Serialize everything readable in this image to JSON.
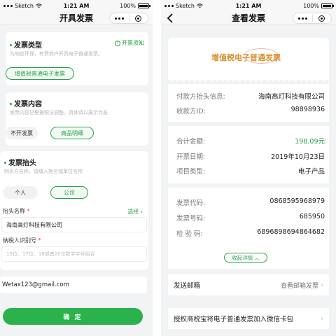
{
  "left": {
    "status": {
      "carrier": "Sketch",
      "time": "1:21 AM",
      "battery": "100%"
    },
    "nav_title": "开具发票",
    "invoice_type": {
      "title": "发票类型",
      "notice": "开票须知",
      "subtitle": "为响应环保，有赞商户开具电子普通发票。",
      "selected": "增值税普通电子发票"
    },
    "invoice_content": {
      "title": "发票内容",
      "subtitle": "发票内容已根据税法调整，具体请以展示为准",
      "options": [
        "不开发票",
        "商品明细"
      ],
      "selected_index": 1
    },
    "invoice_header": {
      "title": "发票抬头",
      "subtitle": "购买方名称，请填入姓名或单位名称",
      "options": [
        "个人",
        "公司"
      ],
      "selected_index": 1,
      "name_label": "抬头名称",
      "select_link": "选择",
      "name_value": "海南高灯科技有限公司",
      "tax_label": "纳税人识别号",
      "tax_placeholder": "15位、17位、18或者20位数字字号组合"
    },
    "email": "Wetax123@gmail.com",
    "confirm_label": "确 定"
  },
  "right": {
    "status": {
      "carrier": "Sketch",
      "time": "1:21 AM",
      "battery": "100%"
    },
    "nav_title": "查看发票",
    "invoice_title": "增值税电子普通发票",
    "payer_label": "付款方抬头信息:",
    "payer_value": "海南高灯科技有限公司",
    "payee_label": "收款方ID:",
    "payee_value": "98898936",
    "total_label": "合计金额:",
    "total_value": "198.09元",
    "date_label": "开票日期:",
    "date_value": "2019年10月23日",
    "category_label": "项目类型:",
    "category_value": "电子产品",
    "code_label": "发票代码:",
    "code_value": "0868595968979",
    "number_label": "发票号码:",
    "number_value": "685950",
    "check_label": "检 验 码:",
    "check_value": "6896898694864682",
    "collapse_label": "收起详情",
    "email_row_label": "发送邮箱",
    "email_row_value": "查看邮箱发票",
    "wechat_row_label": "授权商税宝将电子普通发票加入微信卡包"
  },
  "colors": {
    "accent": "#2aa14b",
    "title_orange": "#d8912a"
  }
}
